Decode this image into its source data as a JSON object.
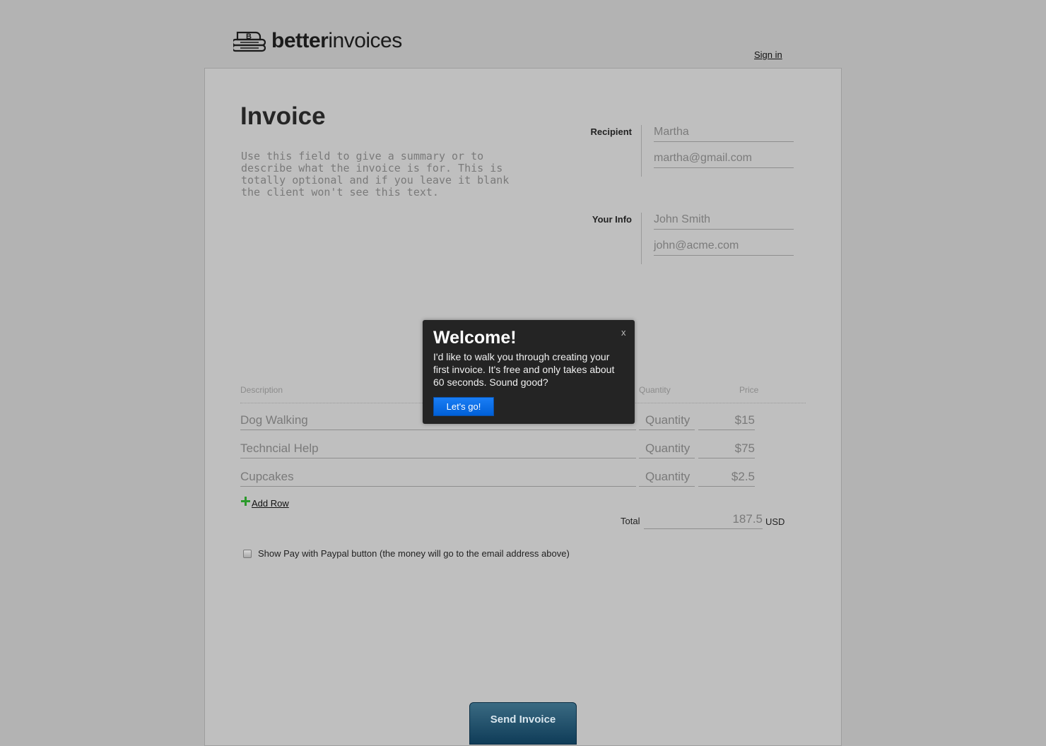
{
  "header": {
    "logo_bold": "better",
    "logo_light": "invoices",
    "signin_label": "Sign in"
  },
  "invoice": {
    "title": "Invoice",
    "summary_placeholder": "Use this field to give a summary or to describe what the invoice is for. This is totally optional and if you leave it blank the client won't see this text."
  },
  "recipient": {
    "label": "Recipient",
    "name": "Martha",
    "email": "martha@gmail.com"
  },
  "your_info": {
    "label": "Your Info",
    "name": "John Smith",
    "email": "john@acme.com"
  },
  "items": {
    "headers": {
      "description": "Description",
      "quantity": "Quantity",
      "price": "Price"
    },
    "rows": [
      {
        "description": "Dog Walking",
        "quantity": "Quantity",
        "price": "$15"
      },
      {
        "description": "Techncial Help",
        "quantity": "Quantity",
        "price": "$75"
      },
      {
        "description": "Cupcakes",
        "quantity": "Quantity",
        "price": "$2.5"
      }
    ],
    "add_row_label": "Add Row"
  },
  "totals": {
    "label": "Total",
    "value": "187.5",
    "currency": "USD"
  },
  "paypal": {
    "checked": false,
    "label": "Show Pay with Paypal button (the money will go to the email address above)"
  },
  "send_button_label": "Send Invoice",
  "welcome_popup": {
    "close_label": "x",
    "title": "Welcome!",
    "body": "I'd like to walk you through creating your first invoice. It's free and only takes about 60 seconds. Sound good?",
    "button_label": "Let's go!"
  },
  "colors": {
    "page_background": "#b3b3b3",
    "sheet_background": "#bfbfbf",
    "popup_background": "#242424",
    "popup_button": "#1a7ef5",
    "send_button": "#0f3c58",
    "add_icon": "#2b9a2b"
  },
  "icons": {
    "logo": "invoice-stack-icon",
    "add_row": "plus-icon",
    "close": "close-icon"
  }
}
